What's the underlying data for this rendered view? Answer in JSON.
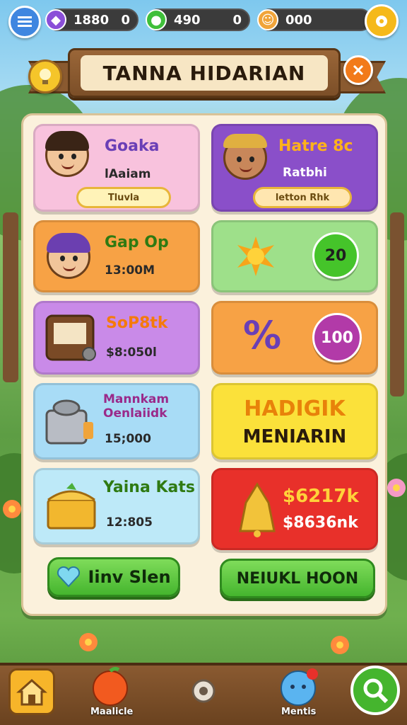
{
  "topbar": {
    "gems": {
      "value": "1880",
      "count": "0"
    },
    "energy": {
      "value": "490",
      "count": "0"
    },
    "pet": {
      "value": "000"
    }
  },
  "title": "TANNA HIDARIAN",
  "cards": {
    "c1": {
      "title": "Goaka",
      "subtitle": "lAaiam",
      "chip": "Tluvla"
    },
    "c2": {
      "title": "Hatre 8c",
      "subtitle": "Ratbhi",
      "chip": "letton Rhk"
    },
    "c3": {
      "title": "Gap Op",
      "subtitle": "13:00M"
    },
    "c4": {
      "value": "20"
    },
    "c5": {
      "title": "SoP8tk",
      "subtitle": "$8:050l"
    },
    "c6": {
      "symbol": "%",
      "value": "100"
    },
    "c7": {
      "title": "Mannkam Oenlaiidk",
      "subtitle": "15;000"
    },
    "c8": {
      "line1": "HADIGIK",
      "line2": "MENIARIN"
    },
    "c9": {
      "title": "Yaina Kats",
      "subtitle": "12:805"
    },
    "c10": {
      "line1": "$6217k",
      "line2": "$8636nk"
    }
  },
  "buttons": {
    "left": "Iinv Slen",
    "right": "NEIUKL HOON"
  },
  "nav": {
    "item1": "Maalicle",
    "item2": "Mentis"
  },
  "colors": {
    "accent_green": "#45b52e",
    "banner_brown": "#7c4f28",
    "panel_cream": "#fbf1dc"
  }
}
